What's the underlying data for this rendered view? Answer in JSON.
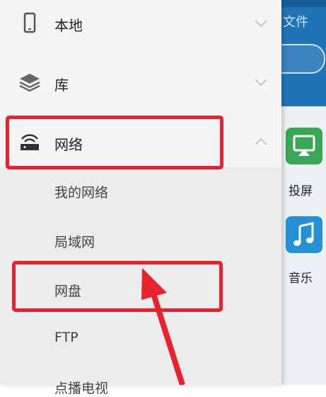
{
  "background_app": {
    "header_text": "文件",
    "tiles": [
      {
        "label": "投屏",
        "icon": "cast-screen-icon",
        "color": "#3aa757"
      },
      {
        "label": "音乐",
        "icon": "music-note-icon",
        "color": "#2491d6"
      }
    ]
  },
  "drawer": {
    "items": [
      {
        "label": "本地",
        "icon": "phone-icon",
        "expanded": false
      },
      {
        "label": "库",
        "icon": "layers-icon",
        "expanded": false
      },
      {
        "label": "网络",
        "icon": "router-wifi-icon",
        "expanded": true
      }
    ],
    "network_subitems": [
      {
        "label": "我的网络"
      },
      {
        "label": "局域网"
      },
      {
        "label": "网盘"
      },
      {
        "label": "FTP"
      },
      {
        "label": "点播电视"
      }
    ]
  },
  "annotation_color": "#e8222e"
}
